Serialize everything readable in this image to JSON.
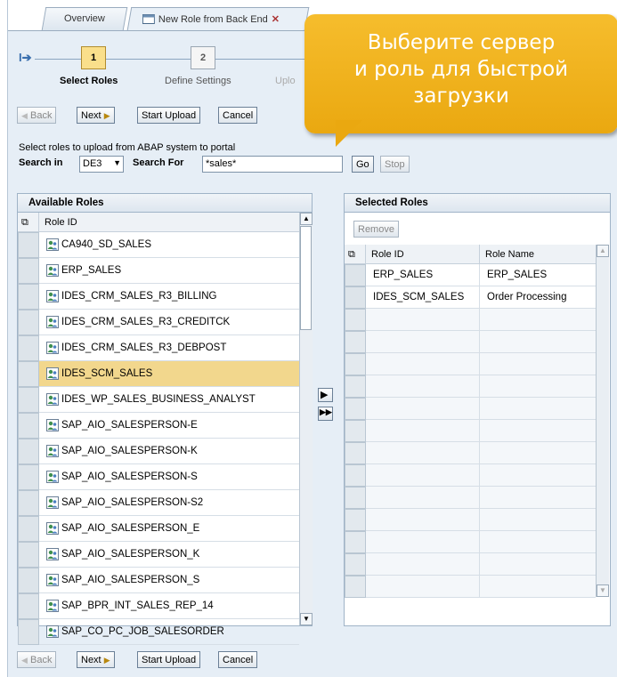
{
  "tabs": [
    {
      "label": "Overview"
    },
    {
      "label": "New Role from Back End"
    }
  ],
  "roadmap": {
    "steps": [
      {
        "number": "1",
        "label": "Select Roles"
      },
      {
        "number": "2",
        "label": "Define Settings"
      },
      {
        "number": "",
        "label": "Uplo"
      }
    ]
  },
  "buttons": {
    "back": "Back",
    "next": "Next",
    "start_upload": "Start Upload",
    "cancel": "Cancel",
    "go": "Go",
    "stop": "Stop",
    "remove": "Remove"
  },
  "search": {
    "description": "Select roles to upload from ABAP system to portal",
    "search_in_label": "Search in",
    "system_value": "DE3",
    "search_for_label": "Search For",
    "query_value": "*sales*"
  },
  "available_roles": {
    "title": "Available Roles",
    "column_header": "Role ID",
    "rows": [
      "CA940_SD_SALES",
      "ERP_SALES",
      "IDES_CRM_SALES_R3_BILLING",
      "IDES_CRM_SALES_R3_CREDITCK",
      "IDES_CRM_SALES_R3_DEBPOST",
      "IDES_SCM_SALES",
      "IDES_WP_SALES_BUSINESS_ANALYST",
      "SAP_AIO_SALESPERSON-E",
      "SAP_AIO_SALESPERSON-K",
      "SAP_AIO_SALESPERSON-S",
      "SAP_AIO_SALESPERSON-S2",
      "SAP_AIO_SALESPERSON_E",
      "SAP_AIO_SALESPERSON_K",
      "SAP_AIO_SALESPERSON_S",
      "SAP_BPR_INT_SALES_REP_14",
      "SAP_CO_PC_JOB_SALESORDER"
    ],
    "highlighted_row": "IDES_SCM_SALES"
  },
  "selected_roles": {
    "title": "Selected Roles",
    "columns": [
      "Role ID",
      "Role Name"
    ],
    "rows": [
      {
        "role_id": "ERP_SALES",
        "role_name": "ERP_SALES"
      },
      {
        "role_id": "IDES_SCM_SALES",
        "role_name": "Order Processing"
      }
    ]
  },
  "callout": {
    "line1": "Выберите сервер",
    "line2": "и роль для быстрой",
    "line3": "загрузки"
  },
  "colors": {
    "highlight": "#f2d78d",
    "callout": "#eaa810",
    "active_step": "#fadf8b"
  }
}
